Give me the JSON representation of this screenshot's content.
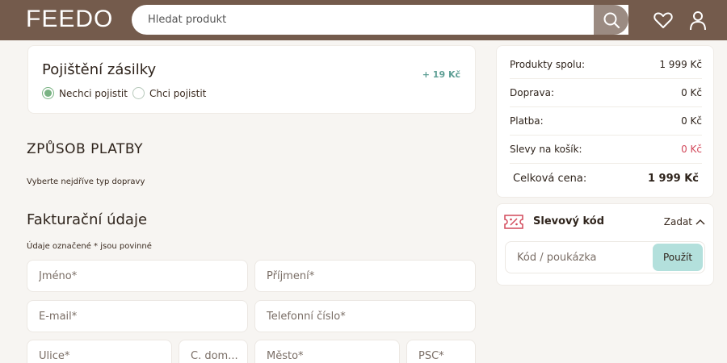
{
  "header": {
    "logo": "FEEDO",
    "search_placeholder": "Hledat produkt",
    "icons": [
      "search-icon",
      "heart-icon",
      "user-icon"
    ]
  },
  "insurance": {
    "title": "Pojištění zásilky",
    "price": "+ 19 Kč",
    "options": [
      {
        "label": "Nechci pojistit",
        "checked": true
      },
      {
        "label": "Chci pojistit",
        "checked": false
      }
    ]
  },
  "payment": {
    "heading": "ZPŮSOB PLATBY",
    "note": "Vyberte nejdříve typ dopravy"
  },
  "billing": {
    "heading": "Fakturační údaje",
    "required_note": "Údaje označené * jsou povinné",
    "fields": {
      "first_name": "Jméno*",
      "last_name": "Příjmení*",
      "email": "E-mail*",
      "phone": "Telefonní číslo*",
      "street": "Ulice*",
      "house_no": "Č. dom...",
      "city": "Město*",
      "zip": "PSČ*"
    }
  },
  "summary": {
    "rows": [
      {
        "label": "Produkty spolu:",
        "value": "1 999 Kč"
      },
      {
        "label": "Doprava:",
        "value": "0 Kč"
      },
      {
        "label": "Platba:",
        "value": "0 Kč"
      },
      {
        "label": "Slevy na košík:",
        "value": "0 Kč"
      }
    ],
    "total_label": "Celková cena:",
    "total_value": "1 999 Kč"
  },
  "discount": {
    "title": "Slevový kód",
    "toggle": "Zadat",
    "placeholder": "Kód / poukázka",
    "apply": "Použít"
  },
  "colors": {
    "header_bg": "#745b4c",
    "accent_green": "#79b383",
    "price_teal": "#5e9f95",
    "discount_red": "#d2485a",
    "apply_bg": "#b3e0dc"
  }
}
